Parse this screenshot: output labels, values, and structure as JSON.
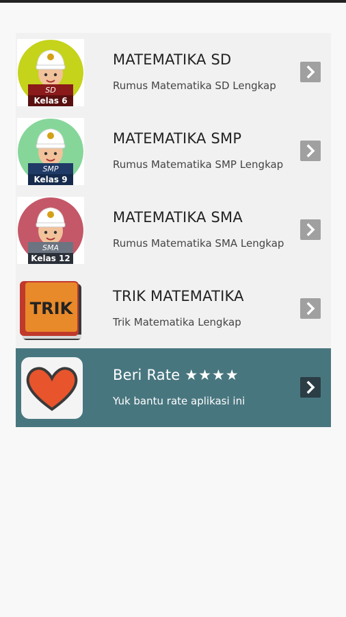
{
  "menu": {
    "items": [
      {
        "title": "MATEMATIKA SD",
        "subtitle": "Rumus Matematika SD Lengkap",
        "icon": "student-sd-icon",
        "level": "SD",
        "kelas": "Kelas 6",
        "circle_color": "#c5d31b"
      },
      {
        "title": "MATEMATIKA SMP",
        "subtitle": "Rumus Matematika SMP Lengkap",
        "icon": "student-smp-icon",
        "level": "SMP",
        "kelas": "Kelas 9",
        "circle_color": "#86d69a"
      },
      {
        "title": "MATEMATIKA SMA",
        "subtitle": "Rumus Matematika SMA Lengkap",
        "icon": "student-sma-icon",
        "level": "SMA",
        "kelas": "Kelas 12",
        "circle_color": "#c45868"
      },
      {
        "title": "TRIK MATEMATIKA",
        "subtitle": "Trik Matematika Lengkap",
        "icon": "trik-book-icon",
        "book_label": "TRIK"
      }
    ],
    "rate": {
      "title": "Beri Rate",
      "stars": "★★★★",
      "subtitle": "Yuk bantu rate aplikasi ini",
      "icon": "heart-icon",
      "background": "#48767f"
    },
    "arrow_icon": "chevron-right-icon"
  }
}
